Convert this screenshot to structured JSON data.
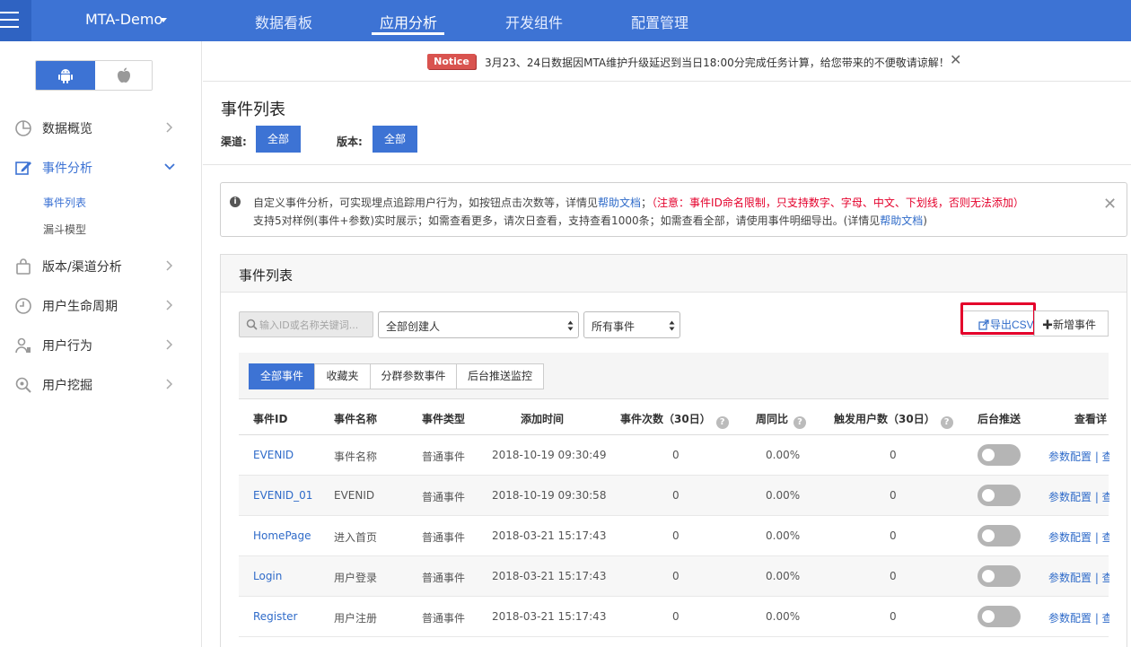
{
  "header": {
    "app_name": "MTA-Demo",
    "nav": [
      {
        "label": "数据看板",
        "active": false
      },
      {
        "label": "应用分析",
        "active": true
      },
      {
        "label": "开发组件",
        "active": false
      },
      {
        "label": "配置管理",
        "active": false
      }
    ]
  },
  "sidebar": {
    "menu": [
      {
        "label": "数据概览",
        "icon": "pie-chart-icon",
        "active": false
      },
      {
        "label": "事件分析",
        "icon": "edit-icon",
        "active": true,
        "expanded": true
      },
      {
        "label": "版本/渠道分析",
        "icon": "bag-icon",
        "active": false
      },
      {
        "label": "用户生命周期",
        "icon": "clock-icon",
        "active": false
      },
      {
        "label": "用户行为",
        "icon": "user-icon",
        "active": false
      },
      {
        "label": "用户挖掘",
        "icon": "magnify-icon",
        "active": false
      }
    ],
    "submenu": [
      {
        "label": "事件列表",
        "active": true
      },
      {
        "label": "漏斗模型",
        "active": false
      }
    ]
  },
  "notice": {
    "badge": "Notice",
    "text": "3月23、24日数据因MTA维护升级延迟到当日18:00分完成任务计算，给您带来的不便敬请谅解！",
    "close": "✕"
  },
  "page": {
    "title": "事件列表",
    "channel_label": "渠道:",
    "channel_value": "全部",
    "version_label": "版本:",
    "version_value": "全部"
  },
  "info": {
    "line1_a": "自定义事件分析，可实现埋点追踪用户行为，如按钮点击次数等，详情见",
    "line1_link": "帮助文档",
    "line1_b": "；",
    "line1_warn": "（注意：事件ID命名限制，只支持数字、字母、中文、下划线，否则无法添加）",
    "line2_a": "支持5对样例(事件+参数)实时展示；如需查看更多，请次日查看，支持查看1000条；如需查看全部，请使用事件明细导出。(详情见",
    "line2_link": "帮助文档",
    "line2_b": ")",
    "close": "✕"
  },
  "panel": {
    "title": "事件列表",
    "search_placeholder": "输入ID或名称关键词...",
    "creator_select": "全部创建人",
    "event_select": "所有事件",
    "export_label": "导出CSV",
    "add_label": "✚新增事件",
    "tabs": [
      "全部事件",
      "收藏夹",
      "分群参数事件",
      "后台推送监控"
    ],
    "columns": [
      "事件ID",
      "事件名称",
      "事件类型",
      "添加时间",
      "事件次数（30日）",
      "周同比",
      "触发用户数（30日）",
      "后台推送",
      "查看详"
    ],
    "rows": [
      {
        "id": "EVENID",
        "name": "事件名称",
        "type": "普通事件",
        "time": "2018-10-19 09:30:49",
        "count": "0",
        "wow": "0.00%",
        "users": "0",
        "actions": "参数配置 | 查"
      },
      {
        "id": "EVENID_01",
        "name": "EVENID",
        "type": "普通事件",
        "time": "2018-10-19 09:30:58",
        "count": "0",
        "wow": "0.00%",
        "users": "0",
        "actions": "参数配置 | 查"
      },
      {
        "id": "HomePage",
        "name": "进入首页",
        "type": "普通事件",
        "time": "2018-03-21 15:17:43",
        "count": "0",
        "wow": "0.00%",
        "users": "0",
        "actions": "参数配置 | 查"
      },
      {
        "id": "Login",
        "name": "用户登录",
        "type": "普通事件",
        "time": "2018-03-21 15:17:43",
        "count": "0",
        "wow": "0.00%",
        "users": "0",
        "actions": "参数配置 | 查"
      },
      {
        "id": "Register",
        "name": "用户注册",
        "type": "普通事件",
        "time": "2018-03-21 15:17:43",
        "count": "0",
        "wow": "0.00%",
        "users": "0",
        "actions": "参数配置 | 查"
      }
    ]
  }
}
